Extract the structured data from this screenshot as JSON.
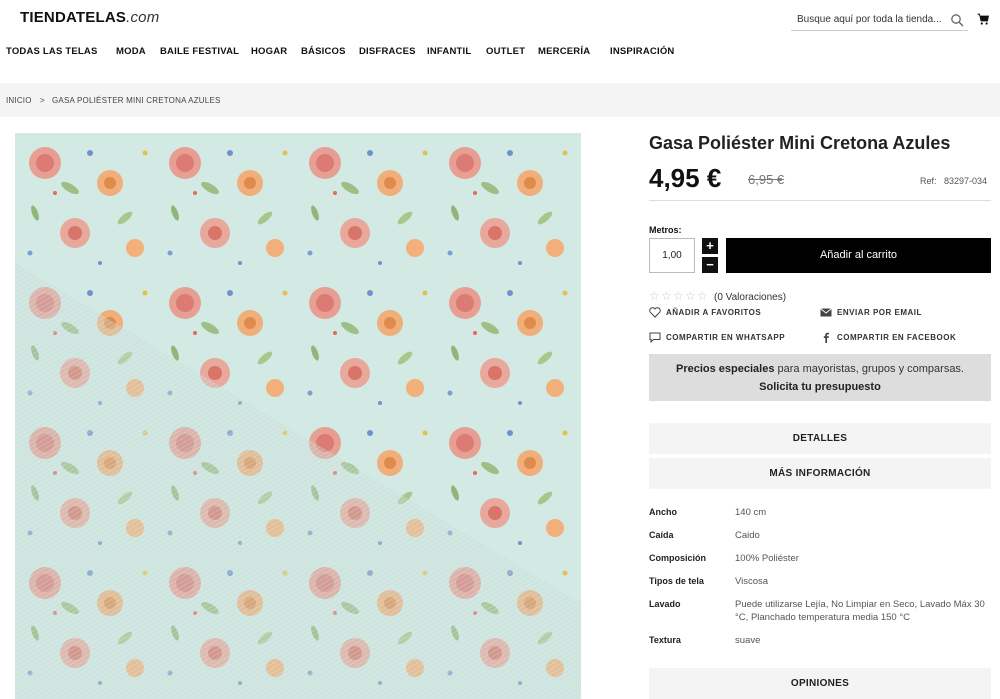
{
  "header": {
    "logo_main": "TIENDATELAS",
    "logo_domain": ".com",
    "search_placeholder": "Busque aquí por toda la tienda...",
    "icons": [
      "search-icon",
      "cart-icon"
    ]
  },
  "nav": [
    "TODAS LAS TELAS",
    "MODA",
    "BAILE FESTIVAL",
    "HOGAR",
    "BÁSICOS",
    "DISFRACES",
    "INFANTIL",
    "OUTLET",
    "MERCERÍA",
    "INSPIRACIÓN"
  ],
  "breadcrumb": {
    "home": "INICIO",
    "separator": ">",
    "current": "GASA POLIÉSTER MINI CRETONA AZULES"
  },
  "product": {
    "title": "Gasa Poliéster Mini Cretona Azules",
    "price": "4,95 €",
    "old_price": "6,95 €",
    "ref_label": "Ref:",
    "ref_value": "83297-034",
    "metros_label": "Metros:",
    "quantity": "1,00",
    "plus": "+",
    "minus": "−",
    "add_to_cart": "Añadir al carrito",
    "reviews": "(0 Valoraciones)",
    "rating_stars": 0
  },
  "actions": {
    "favorites": "AÑADIR A FAVORITOS",
    "email": "ENVIAR POR EMAIL",
    "whatsapp": "COMPARTIR EN WHATSAPP",
    "facebook": "COMPARTIR EN FACEBOOK"
  },
  "promo": {
    "bold": "Precios especiales",
    "rest": " para mayoristas, grupos y comparsas.",
    "cta": "Solicita tu presupuesto"
  },
  "sections": {
    "details": "DETALLES",
    "more_info": "MÁS INFORMACIÓN",
    "reviews": "OPINIONES"
  },
  "specs": [
    {
      "label": "Ancho",
      "value": "140 cm"
    },
    {
      "label": "Caída",
      "value": "Caido"
    },
    {
      "label": "Composición",
      "value": "100% Poliéster"
    },
    {
      "label": "Tipos de tela",
      "value": "Viscosa"
    },
    {
      "label": "Lavado",
      "value": "Puede utilizarse Lejía, No Limpiar en Seco, Lavado Máx 30 °C, Planchado temperatura media 150 °C"
    },
    {
      "label": "Textura",
      "value": "suave"
    }
  ],
  "colors": {
    "accent": "#000000",
    "fabric_base": "#cfe6e1",
    "rose": "#e58a7e",
    "peach": "#f0a56a"
  }
}
